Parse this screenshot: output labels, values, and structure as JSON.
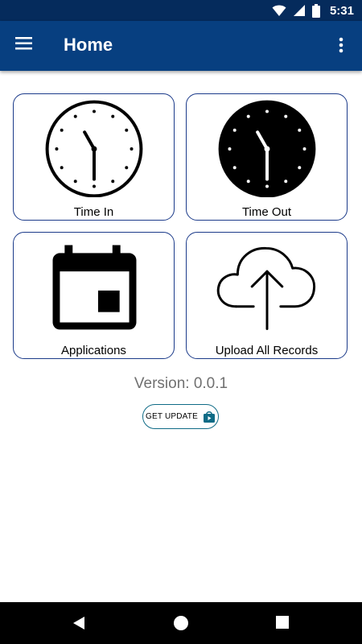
{
  "status_bar": {
    "time": "5:31",
    "icons": [
      "wifi-icon",
      "signal-icon",
      "battery-icon"
    ]
  },
  "app_bar": {
    "title": "Home",
    "menu_icon": "hamburger-menu-icon",
    "overflow_icon": "more-vert-icon",
    "background": "#073f80"
  },
  "tiles": [
    {
      "label": "Time In",
      "icon": "clock-outline-icon"
    },
    {
      "label": "Time Out",
      "icon": "clock-filled-icon"
    },
    {
      "label": "Applications",
      "icon": "calendar-icon"
    },
    {
      "label": "Upload All Records",
      "icon": "cloud-upload-icon"
    }
  ],
  "version_text": "Version: 0.0.1",
  "update_button": {
    "label": "GET UPDATE",
    "icon": "store-bag-icon",
    "accent": "#0f6b86"
  },
  "nav_bar": {
    "buttons": [
      "back-icon",
      "home-icon",
      "recents-icon"
    ]
  }
}
